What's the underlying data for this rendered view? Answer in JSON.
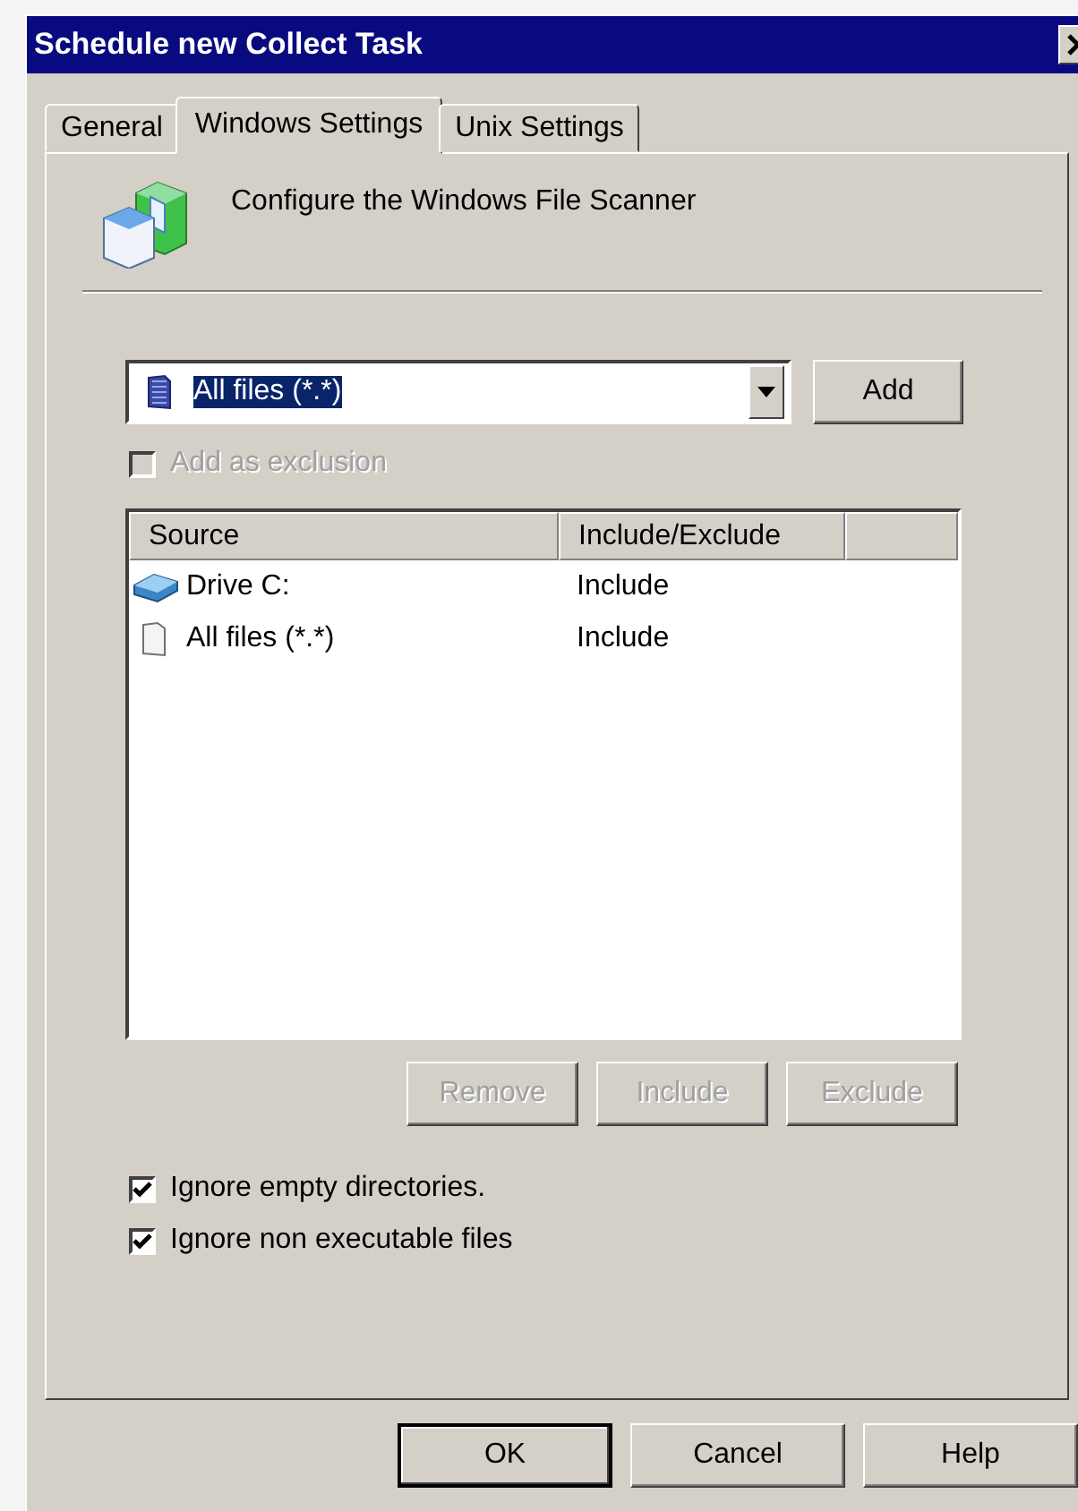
{
  "window": {
    "title": "Schedule new Collect Task"
  },
  "tabs": [
    {
      "label": "General",
      "selected": false
    },
    {
      "label": "Windows Settings",
      "selected": true
    },
    {
      "label": "Unix Settings",
      "selected": false
    }
  ],
  "header": {
    "text": "Configure the Windows File Scanner"
  },
  "filter_combo": {
    "value": "All files (*.*)",
    "text_selected": true
  },
  "add_button": {
    "label": "Add"
  },
  "exclusion_checkbox": {
    "label": "Add as exclusion",
    "checked": false,
    "disabled": true
  },
  "list": {
    "columns": [
      "Source",
      "Include/Exclude"
    ],
    "rows": [
      {
        "kind": "drive",
        "source": "Drive C:",
        "mode": "Include"
      },
      {
        "kind": "file",
        "source": "All files (*.*)",
        "mode": "Include"
      }
    ]
  },
  "list_buttons": [
    {
      "label": "Remove",
      "disabled": true
    },
    {
      "label": "Include",
      "disabled": true
    },
    {
      "label": "Exclude",
      "disabled": true
    }
  ],
  "options": [
    {
      "label": "Ignore empty directories.",
      "checked": true
    },
    {
      "label": "Ignore non executable files",
      "checked": true
    }
  ],
  "dialog_buttons": [
    {
      "label": "OK",
      "default": true
    },
    {
      "label": "Cancel",
      "default": false
    },
    {
      "label": "Help",
      "default": false
    }
  ]
}
